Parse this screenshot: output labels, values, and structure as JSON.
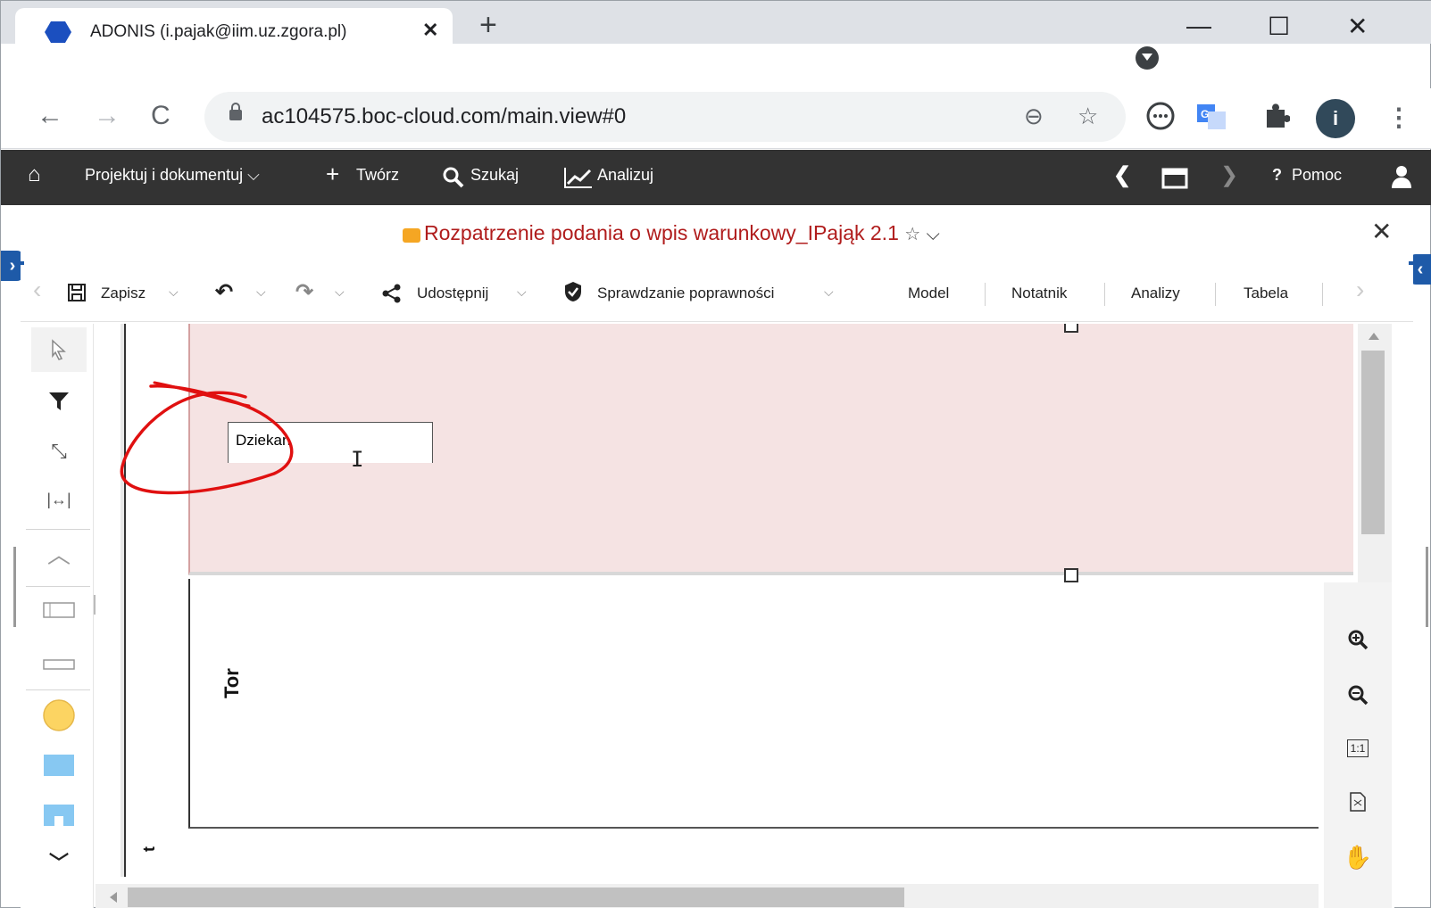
{
  "browser": {
    "tab_title": "ADONIS (i.pajak@iim.uz.zgora.pl)",
    "tab_close": "✕",
    "new_tab": "+",
    "url": "ac104575.boc-cloud.com/main.view#0",
    "avatar_letter": "i",
    "window_controls": {
      "minimize": "—",
      "maximize": "☐",
      "close": "✕"
    }
  },
  "nav": {
    "projektuj": "Projektuj i dokumentuj",
    "tworz": "Twórz",
    "szukaj": "Szukaj",
    "analizuj": "Analizuj",
    "pomoc": "Pomoc"
  },
  "model": {
    "title": "Rozpatrzenie podania o wpis warunkowy_IPająk 2.1",
    "star": "☆",
    "chevron": "⌵",
    "close": "✕"
  },
  "toolbar": {
    "save": "Zapisz",
    "share": "Udostępnij",
    "validate": "Sprawdzanie poprawności",
    "tabs": [
      "Model",
      "Notatnik",
      "Analizy",
      "Tabela"
    ]
  },
  "canvas": {
    "edit_value": "Dziekan",
    "lane_label": "Tor",
    "lane_label_2": "t"
  },
  "zoom": {
    "one_to_one": "1:1"
  },
  "colors": {
    "app_nav_bg": "#333333",
    "title_red": "#b01c1c",
    "lane_selected": "#f5e3e3",
    "annotation_red": "#e01010"
  }
}
